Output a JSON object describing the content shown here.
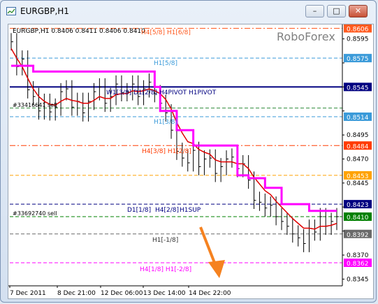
{
  "window": {
    "title": "EURGBP,H1",
    "buttons": [
      "–",
      "□",
      "✕"
    ],
    "app_icon": "chart-window-icon"
  },
  "chart": {
    "header": "EURGBP,H1  0.8406 0.8411 0.8406 0.8410",
    "watermark": "RoboForex",
    "current_price": "0.8410",
    "order_labels": [
      "#33416641 sell",
      "#33692740 sell"
    ],
    "level_labels": {
      "h4_5_8_h1_6_8": "H4[5/8] H1[6/8]",
      "h1_5_8": "H1[5/8]",
      "pivot": "W1[3/8] D1[2/8] H4PIVOT H1PIVOT",
      "h1_3_8": "H1[3/8]",
      "h4_3_8_h1_2_8": "H4[3/8] H1[2/8]",
      "d1_1_8": "D1[1/8]",
      "h4_2_8": "H4[2/8]",
      "h1_sup": "H1SUP",
      "h1_m1_8": "H1[-1/8]",
      "h4_1_8_h1_m2_8": "H4[1/8] H1[-2/8]"
    },
    "colors": {
      "bars": "#000000",
      "fast_ma": "#e00000",
      "slow_line": "#ff00ff",
      "forecast_arrow": "#f58220",
      "pivot": "#000080"
    }
  },
  "chart_data": {
    "type": "line",
    "symbol": "EURGBP",
    "timeframe": "H1",
    "ohlc": {
      "open": 0.8406,
      "high": 0.8411,
      "low": 0.8406,
      "close": 0.841
    },
    "x_ticks": [
      "7 Dec 2011",
      "8 Dec 21:00",
      "12 Dec 06:00",
      "13 Dec 14:00",
      "14 Dec 22:00"
    ],
    "y_ticks": [
      0.8595,
      0.857,
      0.8545,
      0.852,
      0.8495,
      0.847,
      0.8445,
      0.842,
      0.8395,
      0.837,
      0.8345
    ],
    "ylim": [
      0.8338,
      0.861
    ],
    "levels": [
      {
        "value": 0.8606,
        "tag": "0.8606",
        "color": "#ff5a1f",
        "style": "dash-dot"
      },
      {
        "value": 0.8575,
        "tag": "0.8575",
        "color": "#3a9ad9",
        "style": "dash"
      },
      {
        "value": 0.8545,
        "tag": "0.8545",
        "color": "#000080",
        "style": "solid"
      },
      {
        "value": 0.8523,
        "tag": "",
        "color": "#2e8b3a",
        "style": "dash"
      },
      {
        "value": 0.8514,
        "tag": "0.8514",
        "color": "#3a9ad9",
        "style": "dash"
      },
      {
        "value": 0.8484,
        "tag": "0.8484",
        "color": "#ff3b00",
        "style": "dash-dot"
      },
      {
        "value": 0.8453,
        "tag": "0.8453",
        "color": "#ffa200",
        "style": "dash"
      },
      {
        "value": 0.8423,
        "tag": "0.8423",
        "color": "#000080",
        "style": "dash"
      },
      {
        "value": 0.841,
        "tag": "0.8410",
        "color": "#008000",
        "style": "dash"
      },
      {
        "value": 0.8392,
        "tag": "0.8392",
        "color": "#6a6a6a",
        "style": "dash"
      },
      {
        "value": 0.8362,
        "tag": "0.8362",
        "color": "#ff00ff",
        "style": "dash"
      }
    ],
    "series": [
      {
        "name": "",
        "color": "#000000",
        "kind": "price",
        "values": [
          0.8592,
          0.8566,
          0.8574,
          0.8542,
          0.8535,
          0.852,
          0.8529,
          0.8519,
          0.8524,
          0.854,
          0.8543,
          0.8524,
          0.853,
          0.8518,
          0.853,
          0.854,
          0.8545,
          0.8528,
          0.8535,
          0.8548,
          0.8539,
          0.854,
          0.8548,
          0.8535,
          0.8543,
          0.855,
          0.8538,
          0.8528,
          0.8518,
          0.85,
          0.8478,
          0.8471,
          0.8466,
          0.8479,
          0.8462,
          0.847,
          0.8471,
          0.8455,
          0.8462,
          0.847,
          0.8472,
          0.846,
          0.8465,
          0.8448,
          0.8427,
          0.8425,
          0.8419,
          0.8422,
          0.841,
          0.8405,
          0.84,
          0.8392,
          0.8388,
          0.8382,
          0.8398,
          0.8394,
          0.841,
          0.84,
          0.8405,
          0.841
        ]
      },
      {
        "name": "",
        "color": "#e00000",
        "kind": "moving-average",
        "values": [
          0.8585,
          0.8575,
          0.8566,
          0.8554,
          0.8543,
          0.8535,
          0.853,
          0.8527,
          0.8526,
          0.853,
          0.8533,
          0.8531,
          0.853,
          0.8528,
          0.8528,
          0.8531,
          0.8535,
          0.8533,
          0.8533,
          0.8537,
          0.8538,
          0.8538,
          0.8541,
          0.854,
          0.8541,
          0.8543,
          0.8541,
          0.8538,
          0.8532,
          0.8522,
          0.8508,
          0.8497,
          0.8488,
          0.8486,
          0.848,
          0.8477,
          0.8475,
          0.8469,
          0.8467,
          0.8467,
          0.8467,
          0.8465,
          0.8465,
          0.846,
          0.8451,
          0.8444,
          0.8437,
          0.8433,
          0.8426,
          0.842,
          0.8414,
          0.8408,
          0.8403,
          0.8398,
          0.8398,
          0.8397,
          0.84,
          0.84,
          0.8401,
          0.8403
        ]
      },
      {
        "name": "",
        "color": "#ff00ff",
        "kind": "step-level",
        "values": [
          0.8567,
          0.8567,
          0.8567,
          0.8567,
          0.8561,
          0.8561,
          0.8561,
          0.8561,
          0.8561,
          0.8561,
          0.8561,
          0.8561,
          0.8561,
          0.8561,
          0.8561,
          0.8561,
          0.8561,
          0.8561,
          0.8561,
          0.8561,
          0.8561,
          0.8561,
          0.8561,
          0.8561,
          0.8561,
          0.8561,
          0.8545,
          0.852,
          0.852,
          0.852,
          0.85,
          0.85,
          0.85,
          0.8484,
          0.8484,
          0.8484,
          0.8484,
          0.8484,
          0.8484,
          0.8484,
          0.8484,
          0.8453,
          0.8453,
          0.845,
          0.845,
          0.845,
          0.844,
          0.844,
          0.844,
          0.8423,
          0.8423,
          0.8423,
          0.8423,
          0.8423,
          0.8416,
          0.8416,
          0.8416,
          0.8416,
          0.8416,
          0.8416
        ]
      }
    ],
    "grid": false,
    "legend": "none"
  }
}
